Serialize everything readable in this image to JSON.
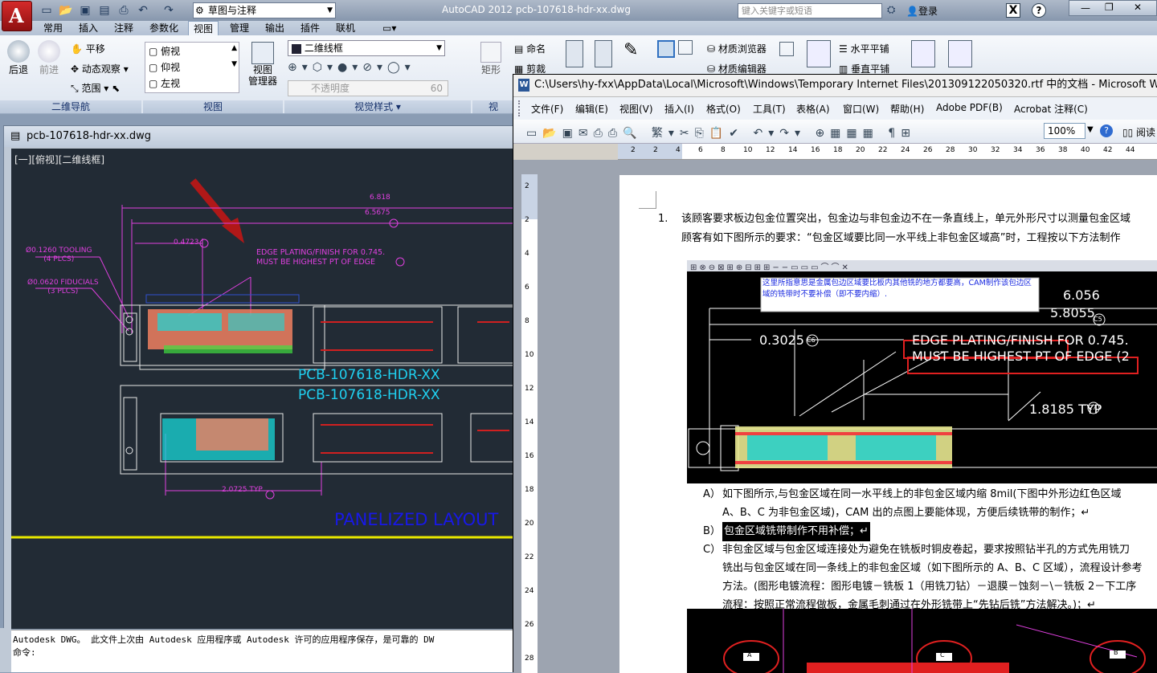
{
  "acad": {
    "title": "AutoCAD 2012    pcb-107618-hdr-xx.dwg",
    "workspace": "草图与注释",
    "search_placeholder": "键入关键字或短语",
    "login": "登录",
    "tabs": [
      "常用",
      "插入",
      "注释",
      "参数化",
      "视图",
      "管理",
      "输出",
      "插件",
      "联机"
    ],
    "active_tab": "视图",
    "ribbon": {
      "nav": {
        "back": "后退",
        "forward": "前进",
        "pan": "平移",
        "orbit": "动态观察",
        "extents": "范围",
        "title": "二维导航"
      },
      "views": {
        "top": "俯视",
        "front": "仰视",
        "left": "左视",
        "manager": "视图\n管理器",
        "title": "视图"
      },
      "visual": {
        "style": "二维线框",
        "opacity": "不透明度",
        "opacity_val": "60",
        "title": "视觉样式"
      },
      "ucs": {
        "label": "矩形",
        "title": "视"
      },
      "named": "命名",
      "clip": "剪裁",
      "materials_browser": "材质浏览器",
      "materials_editor": "材质编辑器",
      "tile_h": "水平平铺",
      "tile_v": "垂直平铺"
    },
    "drawing_window_title": "pcb-107618-hdr-xx.dwg",
    "viewport_label": "[一][俯视][二维线框]",
    "drawing": {
      "dim1": "6.818",
      "dim2": "6.5675",
      "dim3": "0.4723",
      "tooling": "Ø0.1260 TOOLING",
      "tooling2": "(4 PLCS)",
      "fiducials": "Ø0.0620 FIDUCIALS",
      "fiducials2": "(3 PLCS)",
      "note1": "EDGE PLATING/FINISH FOR 0.745.",
      "note2": "MUST BE HIGHEST PT OF EDGE",
      "pcb1": "PCB-107618-HDR-XX",
      "pcb2": "PCB-107618-HDR-XX",
      "dim4": "2.0725 TYP",
      "panel": "PANELIZED LAYOUT"
    },
    "cmd_line1": "Autodesk DWG。  此文件上次由 Autodesk 应用程序或 Autodesk 许可的应用程序保存，是可靠的 DW",
    "cmd_line2": "命令:"
  },
  "word": {
    "title": "C:\\Users\\hy-fxx\\AppData\\Local\\Microsoft\\Windows\\Temporary Internet Files\\201309122050320.rtf 中的文档 - Microsoft Word",
    "menu": [
      "文件(F)",
      "编辑(E)",
      "视图(V)",
      "插入(I)",
      "格式(O)",
      "工具(T)",
      "表格(A)",
      "窗口(W)",
      "帮助(H)",
      "Adobe PDF(B)",
      "Acrobat 注释(C)"
    ],
    "zoom": "100%",
    "read": "阅读",
    "para1_num": "1.",
    "para1_line1": "该顾客要求板边包金位置突出，包金边与非包金边不在一条直线上，单元外形尺寸以测量包金区域",
    "para1_line2": "顾客有如下图所示的要求：“包金区域要比同一水平线上非包金区域高”时，工程按以下方法制作",
    "img1": {
      "callout": "这里所指意思是金属包边区域要比板内其他铣的地方都要高，CAM制作该包边区域的铣带时不要补偿（即不要内缩）.",
      "dim1": "6.056",
      "dim2": "5.8055",
      "dim3": "0.3025",
      "note1": "EDGE PLATING/FINISH FOR 0.745.",
      "note2": "MUST BE HIGHEST PT OF EDGE (2",
      "dim4": "1.8185 TYP",
      "tag1": "C5",
      "tag2": "C6",
      "tag3": "C7"
    },
    "itemA_label": "A）",
    "itemA_line1": "如下图所示,与包金区域在同一水平线上的非包金区域内缩 8mil(下图中外形边红色区域",
    "itemA_line2": "A、B、C 为非包金区域)，CAM 出的点图上要能体现，方便后续铣带的制作；↵",
    "itemB_label": "B）",
    "itemB_line1": "包金区域铣带制作不用补偿；↵",
    "itemC_label": "C）",
    "itemC_line1": "非包金区域与包金区域连接处为避免在铣板时铜皮卷起，要求按照钻半孔的方式先用铣刀",
    "itemC_line2": "铣出与包金区域在同一条线上的非包金区域（如下图所示的 A、B、C 区域），流程设计参考",
    "itemC_line3": "方法。(图形电镀流程：图形电镀－铣板 1（用铣刀钻）－退膜－蚀刻－\\－铣板 2－下工序",
    "itemC_line4": "流程：按照正常流程做板，金属毛刺通过在外形铣带上“先钻后铣”方法解决。)；↵",
    "img2_labels": [
      "A",
      "C",
      "B"
    ],
    "ruler_numbers": [
      "2",
      "2",
      "4",
      "6",
      "8",
      "10",
      "12",
      "14",
      "16",
      "18",
      "20",
      "22",
      "24",
      "26",
      "28",
      "30",
      "32",
      "34",
      "36",
      "38",
      "40",
      "42",
      "44"
    ],
    "vruler_numbers": [
      "2",
      "2",
      "4",
      "6",
      "8",
      "10",
      "12",
      "14",
      "16",
      "18",
      "20",
      "22",
      "24",
      "26",
      "28"
    ]
  }
}
